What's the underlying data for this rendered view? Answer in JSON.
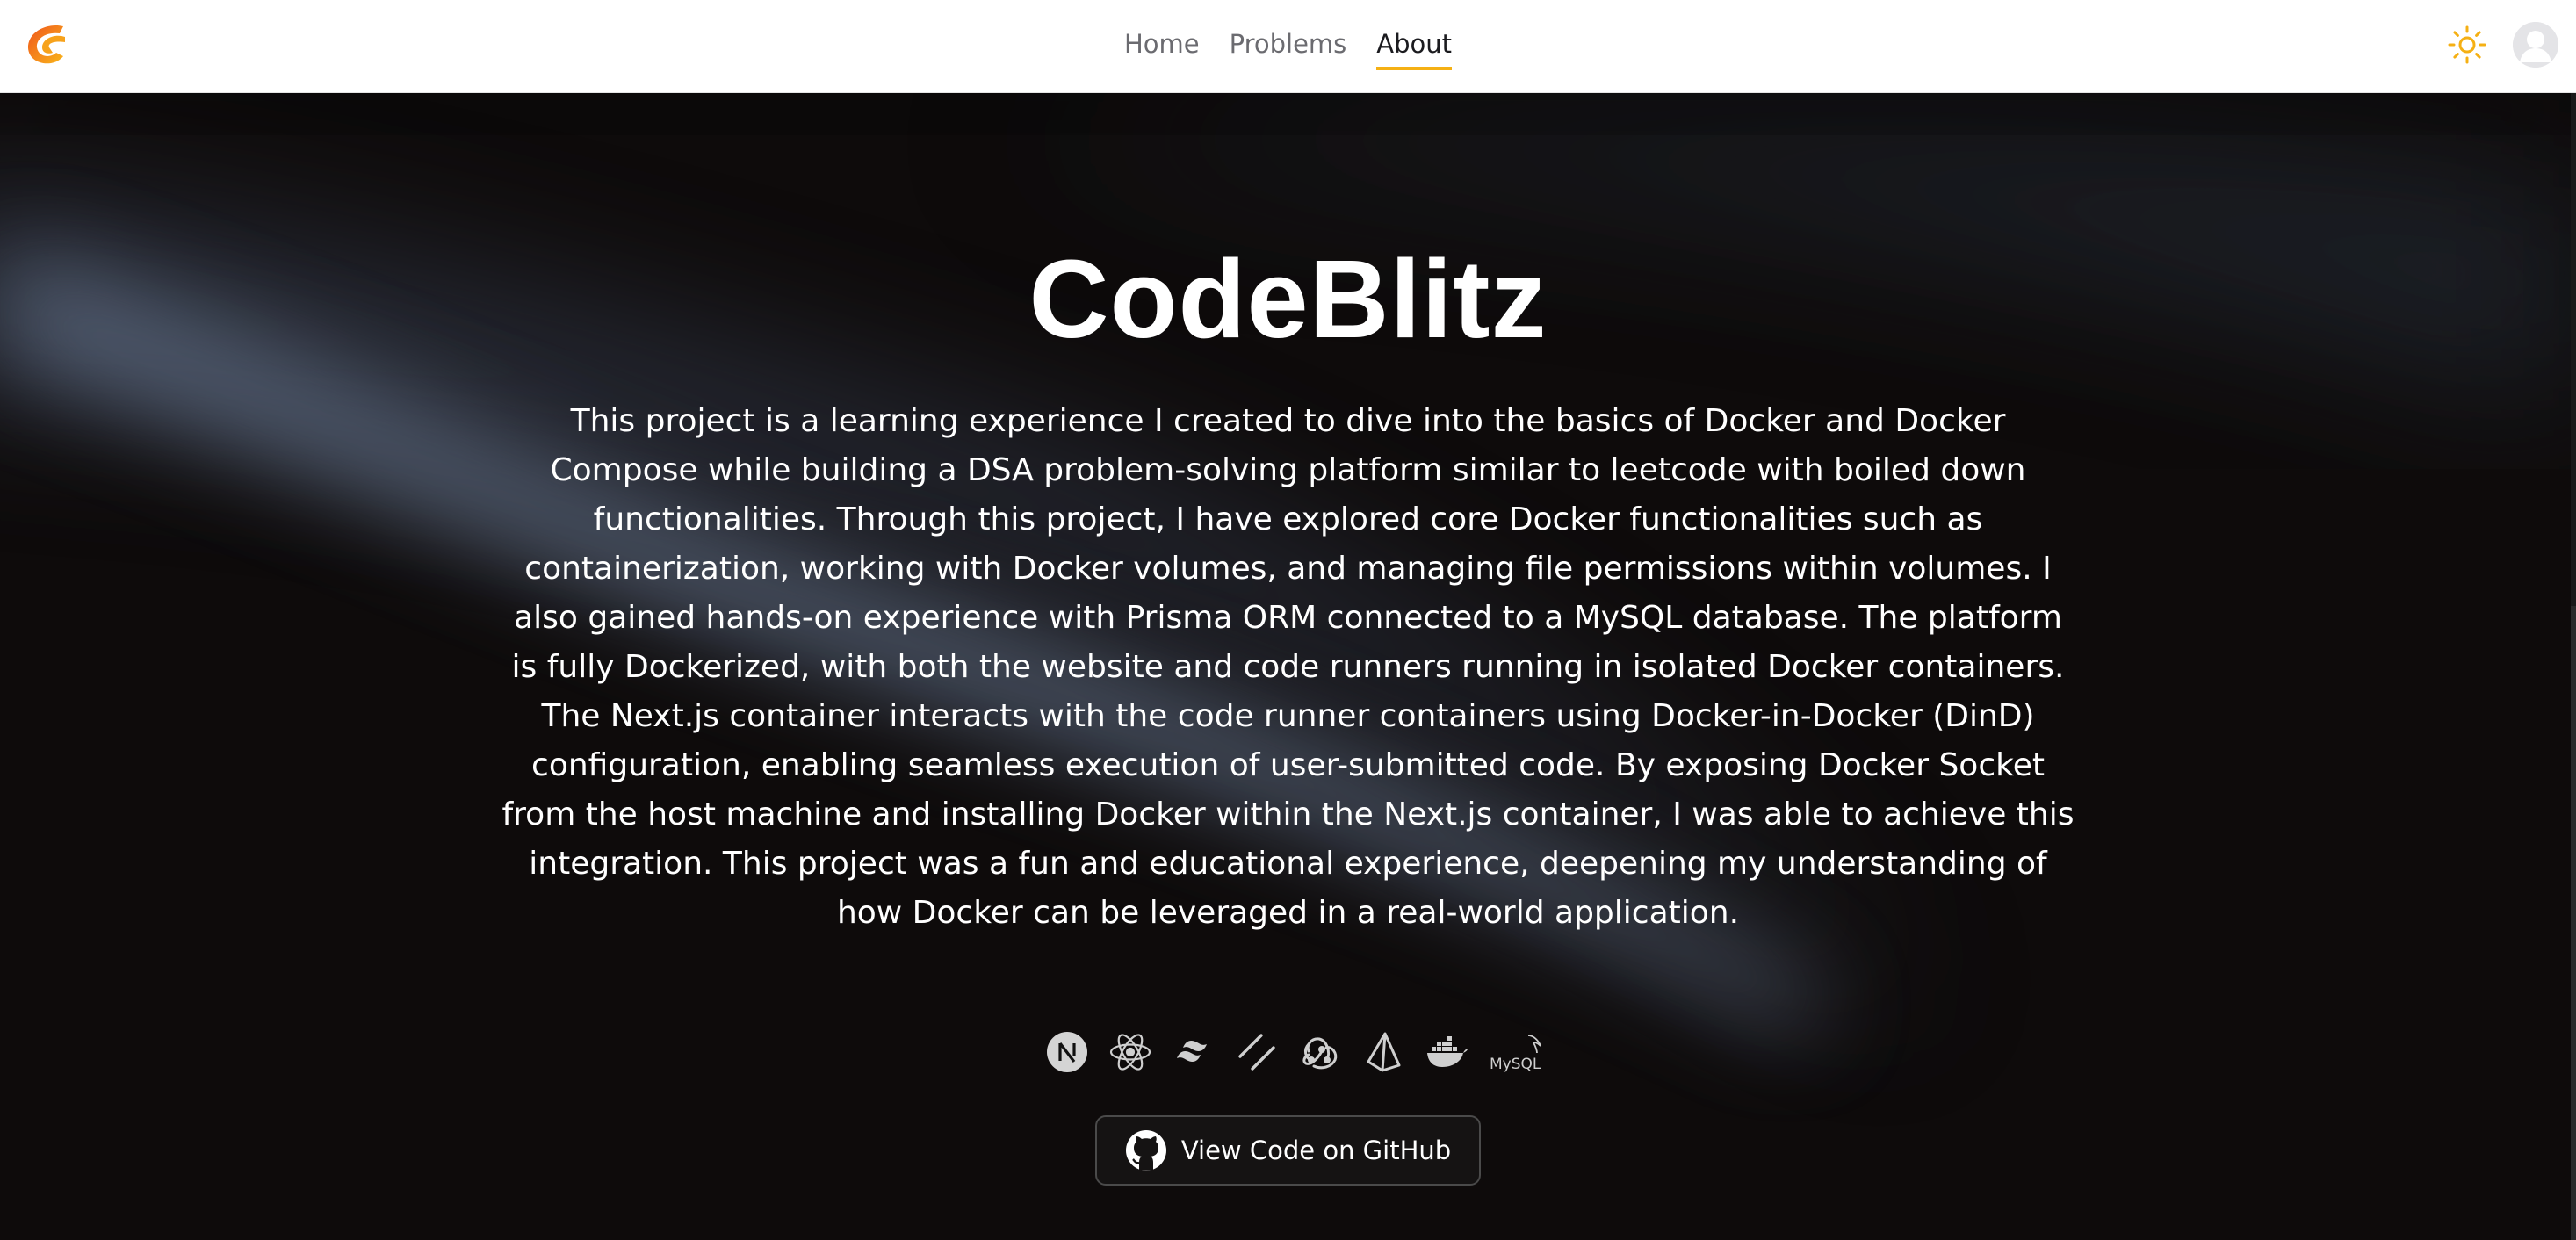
{
  "nav": {
    "links": [
      {
        "label": "Home",
        "active": false
      },
      {
        "label": "Problems",
        "active": false
      },
      {
        "label": "About",
        "active": true
      }
    ],
    "logo_icon": "codeblitz-logo-icon",
    "theme_icon": "sun-icon",
    "avatar_icon": "user-avatar-icon"
  },
  "hero": {
    "title": "CodeBlitz",
    "description": "This project is a learning experience I created to dive into the basics of Docker and Docker Compose while building a DSA problem-solving platform similar to leetcode with boiled down functionalities. Through this project, I have explored core Docker functionalities such as containerization, working with Docker volumes, and managing file permissions within volumes. I also gained hands-on experience with Prisma ORM connected to a MySQL database. The platform is fully Dockerized, with both the website and code runners running in isolated Docker containers. The Next.js container interacts with the code runner containers using Docker-in-Docker (DinD) configuration, enabling seamless execution of user-submitted code. By exposing Docker Socket from the host machine and installing Docker within the Next.js container, I was able to achieve this integration. This project was a fun and educational experience, deepening my understanding of how Docker can be leveraged in a real-world application.",
    "tech_icons": [
      "nextjs-icon",
      "react-icon",
      "tailwind-icon",
      "shadcn-icon",
      "redux-icon",
      "prisma-icon",
      "docker-icon",
      "mysql-icon"
    ],
    "mysql_logo_text": "MySQL",
    "github_button_label": "View Code on GitHub",
    "github_icon": "github-icon"
  },
  "colors": {
    "accent": "#f5b014",
    "background": "#0e0b0b",
    "nav_bg": "#ffffff"
  }
}
